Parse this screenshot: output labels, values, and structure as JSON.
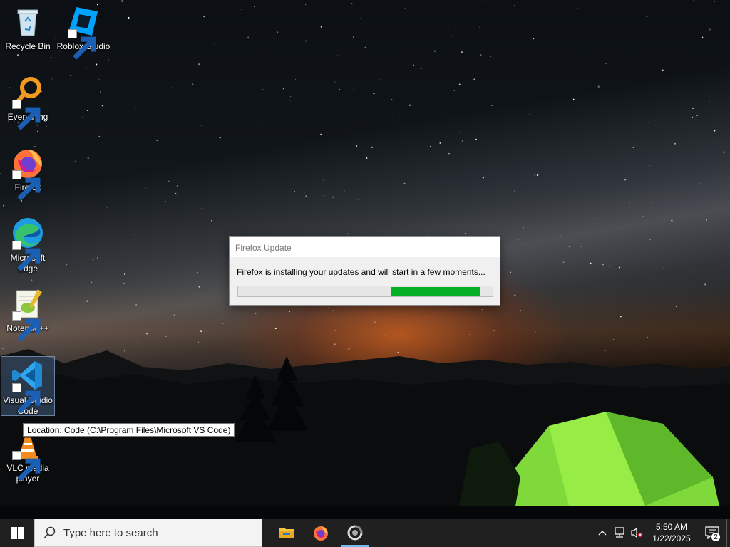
{
  "desktop": {
    "icons": [
      {
        "label": "Recycle Bin",
        "icon": "recycle-bin-icon"
      },
      {
        "label": "Roblox Studio",
        "icon": "roblox-studio-icon"
      },
      {
        "label": "Everything",
        "icon": "everything-search-icon"
      },
      {
        "label": "Firefox",
        "icon": "firefox-icon"
      },
      {
        "label": "Microsoft Edge",
        "icon": "edge-icon"
      },
      {
        "label": "Notepad++",
        "icon": "notepad-plus-plus-icon"
      },
      {
        "label": "Visual Studio Code",
        "icon": "vscode-icon"
      },
      {
        "label": "VLC media player",
        "icon": "vlc-icon"
      }
    ],
    "tooltip": "Location: Code (C:\\Program Files\\Microsoft VS Code)"
  },
  "dialog": {
    "title": "Firefox Update",
    "message": "Firefox is installing your updates and will start in a few moments...",
    "progress": {
      "fill_color": "#06b025",
      "segment_start_percent": 60,
      "segment_end_percent": 95
    }
  },
  "taskbar": {
    "search_placeholder": "Type here to search",
    "apps": [
      {
        "name": "File Explorer",
        "icon": "file-explorer-icon"
      },
      {
        "name": "Firefox",
        "icon": "firefox-icon"
      },
      {
        "name": "Firefox Update",
        "icon": "update-icon",
        "active": true
      }
    ],
    "clock": {
      "time": "5:50 AM",
      "date": "1/22/2025"
    },
    "notification_count": "2",
    "accent_color": "#76b9ed"
  }
}
